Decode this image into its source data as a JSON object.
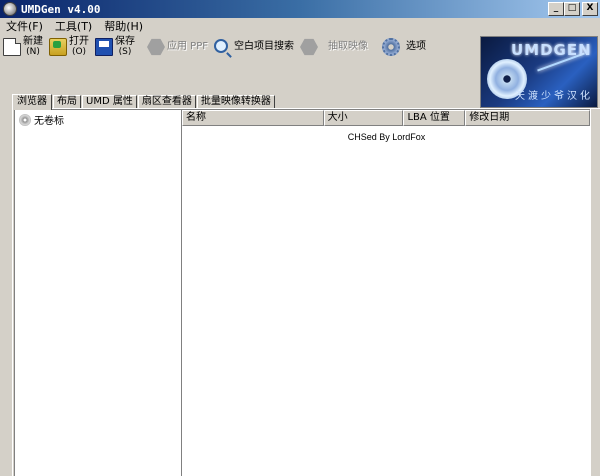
{
  "window": {
    "title": "UMDGen v4.00",
    "buttons": {
      "minimize": "_",
      "maximize": "□",
      "close": "X"
    }
  },
  "menu": [
    {
      "label": "文件(F)"
    },
    {
      "label": "工具(T)"
    },
    {
      "label": "帮助(H)"
    }
  ],
  "toolbar": {
    "new_label": "新建",
    "new_key": "(N)",
    "open_label": "打开",
    "open_key": "(O)",
    "save_label": "保存",
    "save_key": "(S)",
    "apply_ppf_label": "应用 PPF",
    "blank_search_label": "空白项目搜索",
    "extract_image_label": "抽取映像",
    "options_label": "选项"
  },
  "logo": {
    "text": "UMDGEN",
    "subtitle": "天渡少爷汉化"
  },
  "tabs": [
    {
      "label": "浏览器",
      "active": true
    },
    {
      "label": "布局"
    },
    {
      "label": "UMD 属性"
    },
    {
      "label": "扇区查看器"
    },
    {
      "label": "批量映像转换器"
    }
  ],
  "tree": {
    "root_label": "无卷标"
  },
  "list": {
    "columns": [
      "名称",
      "大小",
      "LBA 位置",
      "修改日期"
    ],
    "credit": "CHSed By LordFox"
  }
}
